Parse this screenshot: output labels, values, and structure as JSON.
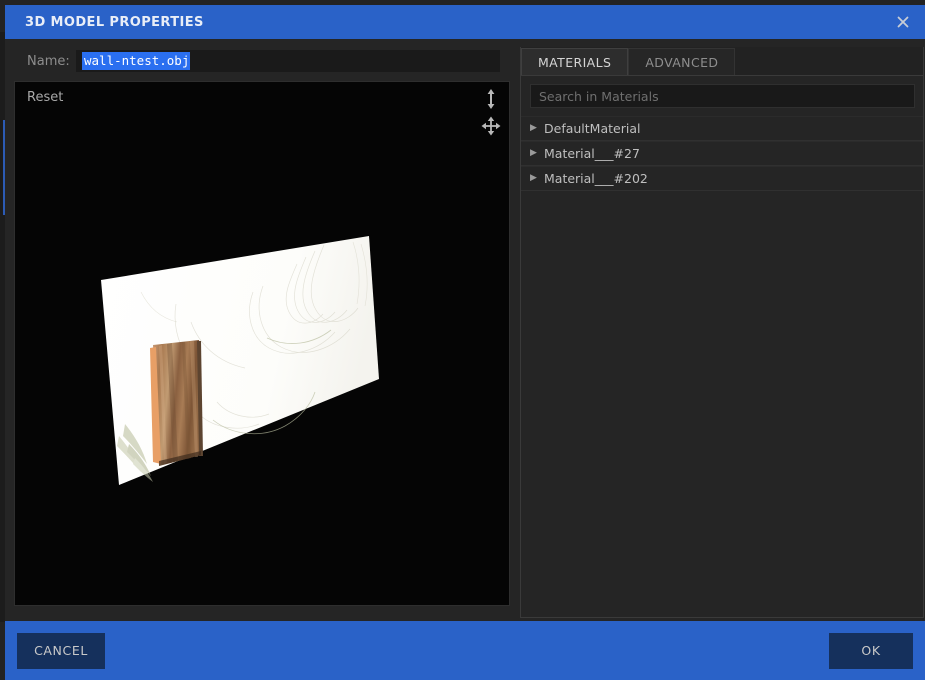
{
  "window": {
    "title": "3D MODEL PROPERTIES",
    "close_icon": "close-icon",
    "accent_color": "#2a62c8",
    "background_color": "#252525"
  },
  "name_field": {
    "label": "Name:",
    "value": "wall-ntest.obj",
    "selected": true,
    "selection_color": "#2a6ff0"
  },
  "viewport": {
    "reset_label": "Reset",
    "background_color": "#050505",
    "icons": [
      {
        "name": "vertical-resize-icon",
        "glyph": "↕"
      },
      {
        "name": "move-icon",
        "glyph": "✥"
      }
    ],
    "model": {
      "name": "wall-ntest.obj",
      "wall_color": "#fdfdfb",
      "door_color": "#8d6142",
      "door_edge_color": "#e09a63"
    }
  },
  "panel": {
    "tabs": [
      {
        "label": "MATERIALS",
        "active": true
      },
      {
        "label": "ADVANCED",
        "active": false
      }
    ],
    "search": {
      "placeholder": "Search in Materials",
      "value": ""
    },
    "materials": [
      {
        "name": "DefaultMaterial",
        "expanded": false
      },
      {
        "name": "Material___#27",
        "expanded": false
      },
      {
        "name": "Material___#202",
        "expanded": false
      }
    ]
  },
  "footer": {
    "cancel_label": "CANCEL",
    "ok_label": "OK",
    "bar_color": "#2a62c8",
    "button_color": "#15305c"
  }
}
